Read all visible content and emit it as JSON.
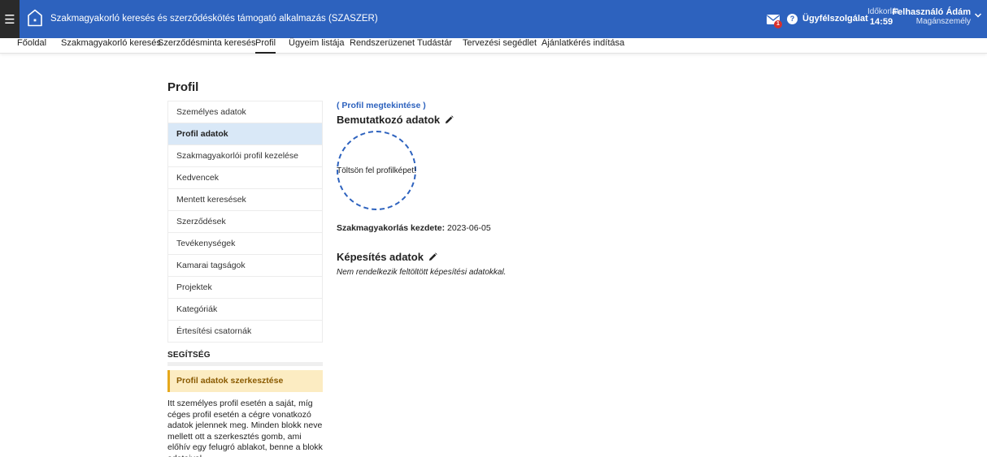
{
  "header": {
    "app_title": "Szakmagyakorló keresés és szerződéskötés támogató alkalmazás (SZASZER)",
    "mail_badge": "1",
    "help_label": "Ügyfélszolgálat",
    "time_label": "Időkorlát",
    "time_value": "14:59",
    "user_name": "Felhasználó Ádám",
    "user_type": "Magánszemély"
  },
  "nav": {
    "items": [
      "Főoldal",
      "Szakmagyakorló keresés",
      "Szerződésminta keresés",
      "Profil",
      "Ügyeim listája",
      "Rendszerüzenet",
      "Tudástár",
      "Tervezési segédlet",
      "Ajánlatkérés indítása"
    ],
    "active": "Profil"
  },
  "page": {
    "title": "Profil"
  },
  "side_menu": {
    "items": [
      "Személyes adatok",
      "Profil adatok",
      "Szakmagyakorlói profil kezelése",
      "Kedvencek",
      "Mentett keresések",
      "Szerződések",
      "Tevékenységek",
      "Kamarai tagságok",
      "Projektek",
      "Kategóriák",
      "Értesítési csatornák"
    ],
    "active": "Profil adatok"
  },
  "help": {
    "heading": "SEGÍTSÉG",
    "box_title": "Profil adatok szerkesztése",
    "text": "Itt személyes profil esetén a saját, míg céges profil esetén a cégre vonatkozó adatok jelennek meg. Minden blokk neve mellett ott a szerkesztés gomb, ami előhív egy felugró ablakot, benne a blokk adataival."
  },
  "content": {
    "view_link": "( Profil megtekintése )",
    "intro_title": "Bemutatkozó adatok",
    "avatar_text": "Töltsön fel profilképet!",
    "start_label": "Szakmagyakorlás kezdete:",
    "start_value": "2023-06-05",
    "qual_title": "Képesítés adatok",
    "qual_empty": "Nem rendelkezik feltöltött képesítési adatokkal."
  },
  "colors": {
    "primary": "#2d62be",
    "active_menu_bg": "#d9e8f7",
    "help_box_bg": "#fcecc2",
    "help_box_accent": "#e6a91d",
    "badge": "#d9302c"
  },
  "icons": {
    "menu": "hamburger-icon",
    "logo": "house-logo-icon",
    "mail": "envelope-icon",
    "help": "question-circle-icon",
    "user_menu": "chevron-down-icon",
    "edit": "pencil-icon"
  }
}
